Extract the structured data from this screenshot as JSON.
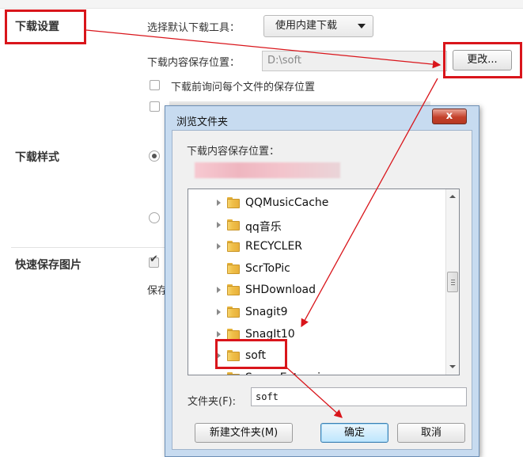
{
  "settings": {
    "download_settings_title": "下载设置",
    "choose_tool_label": "选择默认下载工具：",
    "tool_select_value": "使用内建下载",
    "save_location_label": "下载内容保存位置：",
    "save_location_value": "D:\\soft",
    "change_button": "更改...",
    "ask_each_file_label": "下载前询问每个文件的保存位置",
    "download_style_title": "下载样式",
    "quick_save_title": "快速保存图片",
    "partial_save_text": "保存"
  },
  "dialog": {
    "title": "浏览文件夹",
    "close_label": "x",
    "heading": "下载内容保存位置：",
    "folders": [
      {
        "name": "QQMusicCache",
        "expandable": true
      },
      {
        "name": "qq音乐",
        "expandable": true
      },
      {
        "name": "RECYCLER",
        "expandable": true
      },
      {
        "name": "ScrToPic",
        "expandable": false
      },
      {
        "name": "SHDownload",
        "expandable": true
      },
      {
        "name": "Snagit9",
        "expandable": true
      },
      {
        "name": "SnagIt10",
        "expandable": true
      },
      {
        "name": "soft",
        "expandable": true,
        "selected": true
      },
      {
        "name": "SogouExtension",
        "expandable": true
      }
    ],
    "folder_label": "文件夹(F):",
    "folder_value": "soft",
    "new_folder_button": "新建文件夹(M)",
    "ok_button": "确定",
    "cancel_button": "取消"
  },
  "annotation_color": "#d9151b"
}
